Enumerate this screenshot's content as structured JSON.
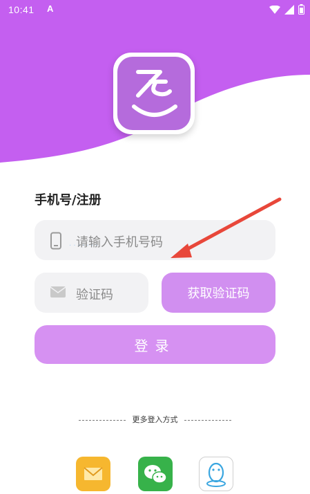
{
  "status_bar": {
    "time": "10:41",
    "notification_glyph": "A"
  },
  "colors": {
    "brand_purple": "#c45ff0",
    "button_purple": "#d18ff0",
    "annotation_arrow": "#e8473a"
  },
  "form": {
    "title": "手机号/注册",
    "phone_placeholder": "请输入手机号码",
    "code_placeholder": "验证码",
    "get_code_label": "获取验证码",
    "login_label": "登录"
  },
  "more_login": {
    "label": "更多登入方式"
  },
  "social": [
    {
      "name": "mail",
      "icon": "envelope-icon"
    },
    {
      "name": "wechat",
      "icon": "wechat-icon"
    },
    {
      "name": "qq",
      "icon": "qq-penguin-icon"
    }
  ]
}
